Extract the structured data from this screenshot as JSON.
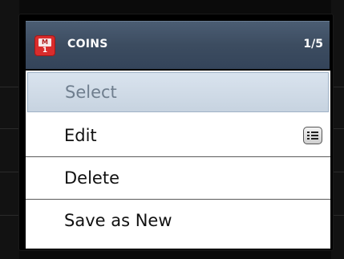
{
  "dialog": {
    "title": "COINS",
    "count": "1/5",
    "icon": {
      "name": "calendar-m1-icon",
      "top_text": "M",
      "bottom_text": "1",
      "color": "#d92c2c"
    }
  },
  "menu": {
    "items": [
      {
        "label": "Select",
        "state": "highlighted"
      },
      {
        "label": "Edit",
        "icon": "list-icon"
      },
      {
        "label": "Delete"
      },
      {
        "label": "Save as New"
      }
    ]
  },
  "colors": {
    "header": "#3c4c60",
    "highlight": "#c7d3e0",
    "menu_bg": "#ffffff"
  }
}
